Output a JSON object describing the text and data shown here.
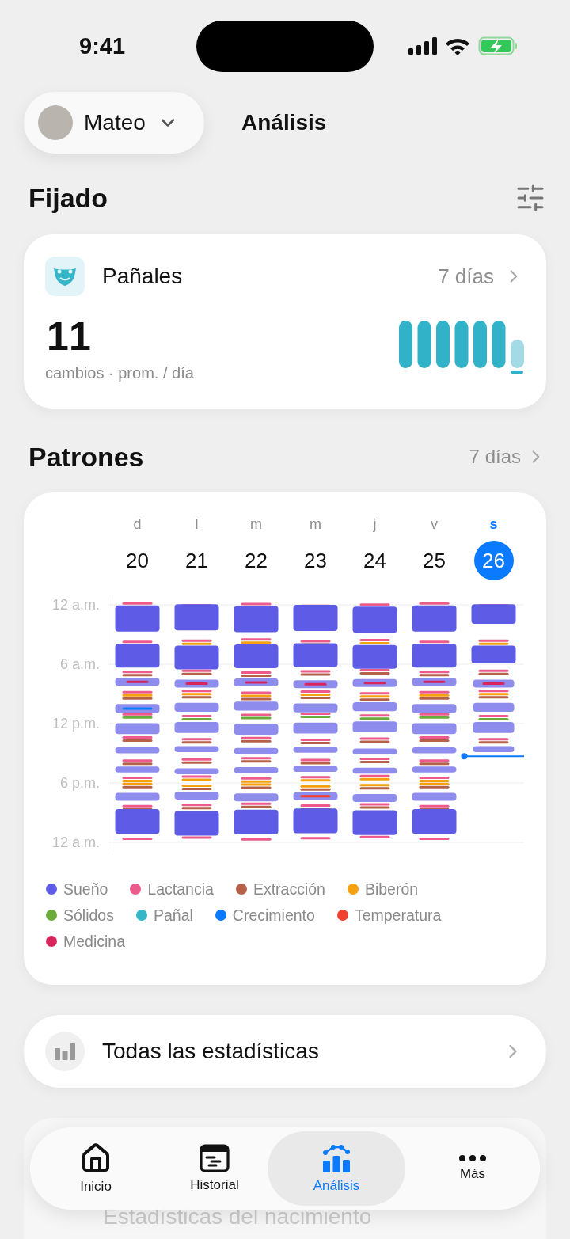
{
  "status_bar": {
    "time": "9:41"
  },
  "header": {
    "child_name": "Mateo",
    "title": "Análisis"
  },
  "pinned": {
    "title": "Fijado",
    "card": {
      "title": "Pañales",
      "range": "7 días",
      "value": "11",
      "caption": "cambios · prom. / día"
    }
  },
  "patterns": {
    "title": "Patrones",
    "range": "7 días",
    "days": [
      {
        "weekday": "d",
        "date": "20",
        "selected": false
      },
      {
        "weekday": "l",
        "date": "21",
        "selected": false
      },
      {
        "weekday": "m",
        "date": "22",
        "selected": false
      },
      {
        "weekday": "m",
        "date": "23",
        "selected": false
      },
      {
        "weekday": "j",
        "date": "24",
        "selected": false
      },
      {
        "weekday": "v",
        "date": "25",
        "selected": false
      },
      {
        "weekday": "s",
        "date": "26",
        "selected": true
      }
    ],
    "time_labels": [
      "12 a.m.",
      "6 a.m.",
      "12 p.m.",
      "6 p.m.",
      "12 a.m."
    ],
    "legend": [
      {
        "label": "Sueño",
        "color": "#5e5ce6"
      },
      {
        "label": "Lactancia",
        "color": "#ec5b8c"
      },
      {
        "label": "Extracción",
        "color": "#b5614a"
      },
      {
        "label": "Biberón",
        "color": "#f5a00f"
      },
      {
        "label": "Sólidos",
        "color": "#6aab3a"
      },
      {
        "label": "Pañal",
        "color": "#35b6c8"
      },
      {
        "label": "Crecimiento",
        "color": "#0a7aff"
      },
      {
        "label": "Temperatura",
        "color": "#f2402f"
      },
      {
        "label": "Medicina",
        "color": "#d6245c"
      }
    ]
  },
  "all_stats": {
    "label": "Todas las estadísticas"
  },
  "faded_card": {
    "label": "Estadísticas del nacimiento"
  },
  "tab_bar": [
    {
      "label": "Inicio",
      "kind": "home",
      "selected": false
    },
    {
      "label": "Historial",
      "kind": "history",
      "selected": false
    },
    {
      "label": "Análisis",
      "kind": "analysis",
      "selected": true
    },
    {
      "label": "Más",
      "kind": "more",
      "selected": false
    }
  ]
}
